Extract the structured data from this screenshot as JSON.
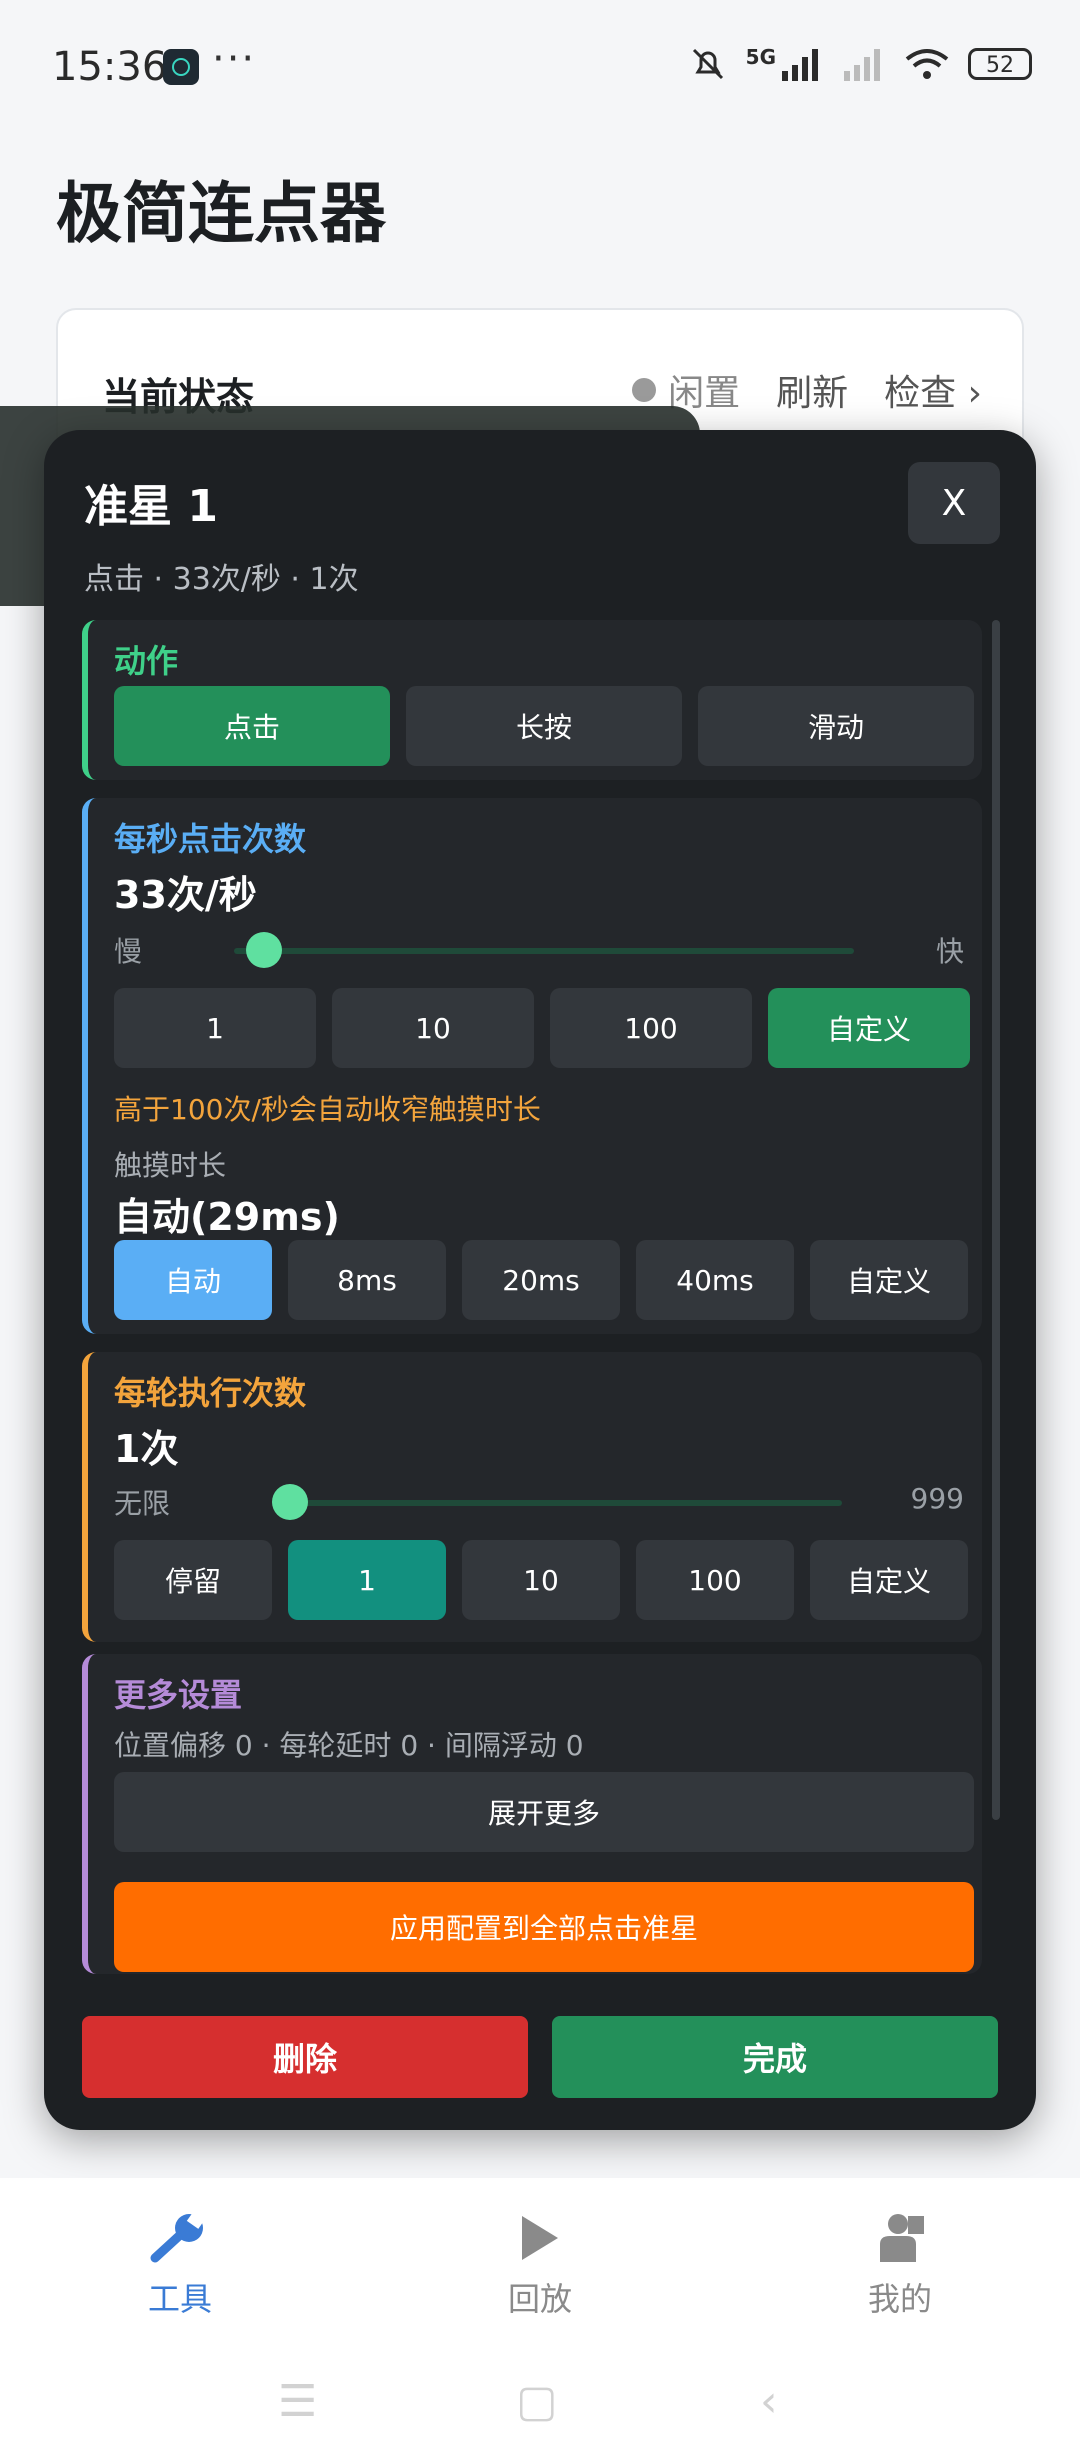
{
  "status_bar": {
    "time": "15:36",
    "more": "···",
    "network": "5G",
    "battery": "52"
  },
  "background": {
    "app_title": "极简连点器",
    "status_card": {
      "title": "当前状态",
      "state": "闲置",
      "refresh": "刷新",
      "check": "检查 ›"
    }
  },
  "modal": {
    "title": "准星 1",
    "subtitle": "点击 · 33次/秒 · 1次",
    "close_label": "X",
    "action": {
      "heading": "动作",
      "options": [
        "点击",
        "长按",
        "滑动"
      ],
      "selected": "点击"
    },
    "cps": {
      "heading": "每秒点击次数",
      "value": "33次/秒",
      "slider_min_label": "慢",
      "slider_max_label": "快",
      "slider_level": 0.02,
      "presets": [
        "1",
        "10",
        "100",
        "自定义"
      ],
      "selected": "自定义",
      "warning": "高于100次/秒会自动收窄触摸时长",
      "touch_label": "触摸时长",
      "touch_value": "自动(29ms)",
      "touch_options": [
        "自动",
        "8ms",
        "20ms",
        "40ms",
        "自定义"
      ],
      "touch_selected": "自动"
    },
    "rounds": {
      "heading": "每轮执行次数",
      "value": "1次",
      "slider_min_label": "无限",
      "slider_max_label": "999",
      "slider_level": 0.0,
      "options": [
        "停留",
        "1",
        "10",
        "100",
        "自定义"
      ],
      "selected": "1"
    },
    "more": {
      "heading": "更多设置",
      "summary": "位置偏移 0 · 每轮延时 0 · 间隔浮动 0",
      "expand_label": "展开更多",
      "apply_label": "应用配置到全部点击准星"
    },
    "delete_label": "删除",
    "done_label": "完成"
  },
  "bottom_nav": {
    "items": [
      {
        "label": "工具",
        "icon": "wrench-icon",
        "active": true
      },
      {
        "label": "回放",
        "icon": "play-icon",
        "active": false
      },
      {
        "label": "我的",
        "icon": "person-icon",
        "active": false
      }
    ]
  },
  "colors": {
    "green": "#23905a",
    "blue": "#5aaef5",
    "teal": "#12907f",
    "orange": "#ff6d00",
    "red": "#d62f2f",
    "action_accent": "#3fd089",
    "cps_accent": "#5aaef5",
    "rounds_accent": "#f3a43c",
    "more_accent": "#b58bd8"
  }
}
